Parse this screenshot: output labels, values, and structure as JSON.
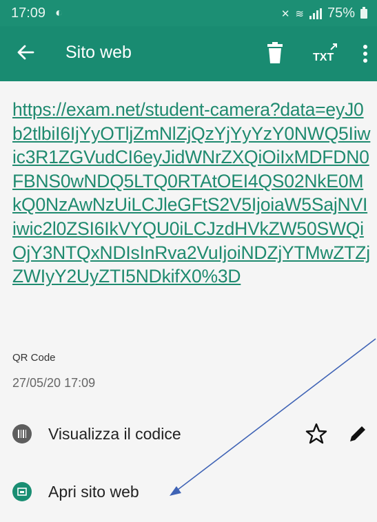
{
  "status_bar": {
    "time": "17:09",
    "battery": "75%"
  },
  "app_bar": {
    "title": "Sito web",
    "icons": [
      "back-arrow-icon",
      "trash-icon",
      "text-export-icon",
      "more-vert-icon"
    ]
  },
  "content": {
    "url": "https://exam.net/student-camera?data=eyJ0b2tlbiI6IjYyOTljZmNlZjQzYjYyYzY0NWQ5Iiwic3R1ZGVudCI6eyJidWNrZXQiOiIxMDFDN0FBNS0wNDQ5LTQ0RTAtOEI4QS02NkE0MkQ0NzAwNzUiLCJleGFtS2V5IjoiaW5SajNVIiwic2l0ZSI6IkVYQU0iLCJzdHVkZW50SWQiOjY3NTQxNDIsInRva2VuIjoiNDZjYTMwZTZjZWIyY2UyZTI5NDkifX0%3D",
    "type": "QR Code",
    "date": "27/05/20 17:09"
  },
  "actions": {
    "view_code": "Visualizza il codice",
    "open_site": "Apri sito web"
  },
  "colors": {
    "accent": "#198b71",
    "status": "#1c8f74",
    "link": "#1f8a6f",
    "annotation_arrow": "#3f63b5"
  }
}
